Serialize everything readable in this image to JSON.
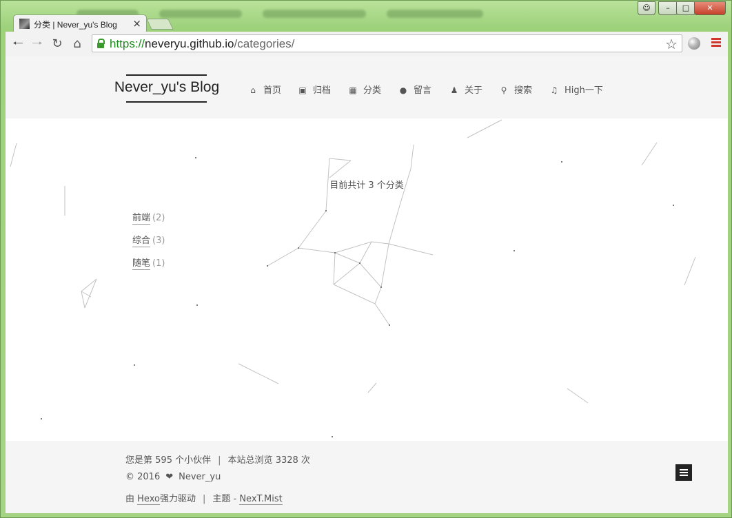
{
  "browser": {
    "tab_title": "分类 | Never_yu's Blog",
    "tab_close": "×",
    "url_scheme": "https://",
    "url_host": "neveryu.github.io",
    "url_path": "/categories/"
  },
  "site": {
    "brand": "Never_yu's Blog",
    "nav": [
      {
        "label": "首页",
        "icon": "home-icon"
      },
      {
        "label": "归档",
        "icon": "archive-icon"
      },
      {
        "label": "分类",
        "icon": "grid-icon"
      },
      {
        "label": "留言",
        "icon": "comment-icon"
      },
      {
        "label": "关于",
        "icon": "user-icon"
      },
      {
        "label": "搜索",
        "icon": "search-icon"
      },
      {
        "label": "High一下",
        "icon": "music-icon"
      }
    ]
  },
  "content": {
    "summary": "目前共计 3 个分类",
    "categories": [
      {
        "name": "前端",
        "count": "(2)"
      },
      {
        "name": "综合",
        "count": "(3)"
      },
      {
        "name": "随笔",
        "count": "(1)"
      }
    ]
  },
  "footer": {
    "visitor_prefix": "您是第",
    "visitor_count": "595",
    "visitor_suffix": "个小伙伴",
    "separator": "|",
    "pv_prefix": "本站总浏览",
    "pv_count": "3328",
    "pv_suffix": "次",
    "copyright": "© 2016",
    "author": "Never_yu",
    "powered_prefix": "由",
    "powered_link": "Hexo",
    "powered_suffix": "强力驱动",
    "theme_prefix": "主题 -",
    "theme_link": "NexT.Mist"
  },
  "colors": {
    "window_frame": "#a6d485",
    "https_green": "#1d8a1d",
    "chrome_menu_red": "#d0372a"
  }
}
